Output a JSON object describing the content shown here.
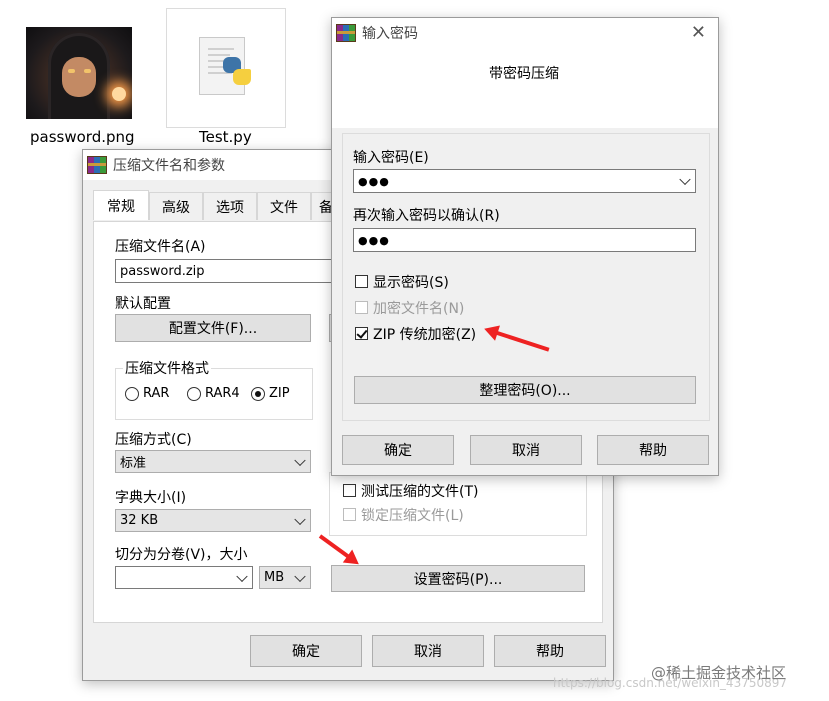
{
  "desktop": {
    "files": [
      {
        "name": "password.png",
        "icon": "hooded-figure-thumbnail"
      },
      {
        "name": "Test.py",
        "icon": "python-file-icon"
      }
    ]
  },
  "main_dialog": {
    "title": "压缩文件名和参数",
    "tabs": [
      "常规",
      "高级",
      "选项",
      "文件",
      "备"
    ],
    "archive_name_label": "压缩文件名(A)",
    "archive_name_value": "password.zip",
    "default_profile_label": "默认配置",
    "profile_button": "配置文件(F)...",
    "format_group_label": "压缩文件格式",
    "formats": [
      "RAR",
      "RAR4",
      "ZIP"
    ],
    "selected_format": "ZIP",
    "method_label": "压缩方式(C)",
    "method_value": "标准",
    "dict_label": "字典大小(I)",
    "dict_value": "32 KB",
    "split_label": "切分为分卷(V)，大小",
    "split_unit": "MB",
    "test_archive_label": "测试压缩的文件(T)",
    "lock_archive_label": "锁定压缩文件(L)",
    "set_password_button": "设置密码(P)...",
    "ok": "确定",
    "cancel": "取消",
    "help": "帮助"
  },
  "pwd_dialog": {
    "title": "输入密码",
    "heading": "带密码压缩",
    "enter_label": "输入密码(E)",
    "enter_value": "●●●",
    "reenter_label": "再次输入密码以确认(R)",
    "reenter_value": "●●●",
    "show_password": "显示密码(S)",
    "encrypt_names": "加密文件名(N)",
    "zip_legacy": "ZIP 传统加密(Z)",
    "organize_button": "整理密码(O)...",
    "ok": "确定",
    "cancel": "取消",
    "help": "帮助",
    "close_glyph": "✕"
  },
  "watermarks": {
    "brand": "@稀土掘金技术社区",
    "url": "https://blog.csdn.net/weixin_43750897"
  },
  "colors": {
    "annotation_arrow": "#ee2222"
  }
}
